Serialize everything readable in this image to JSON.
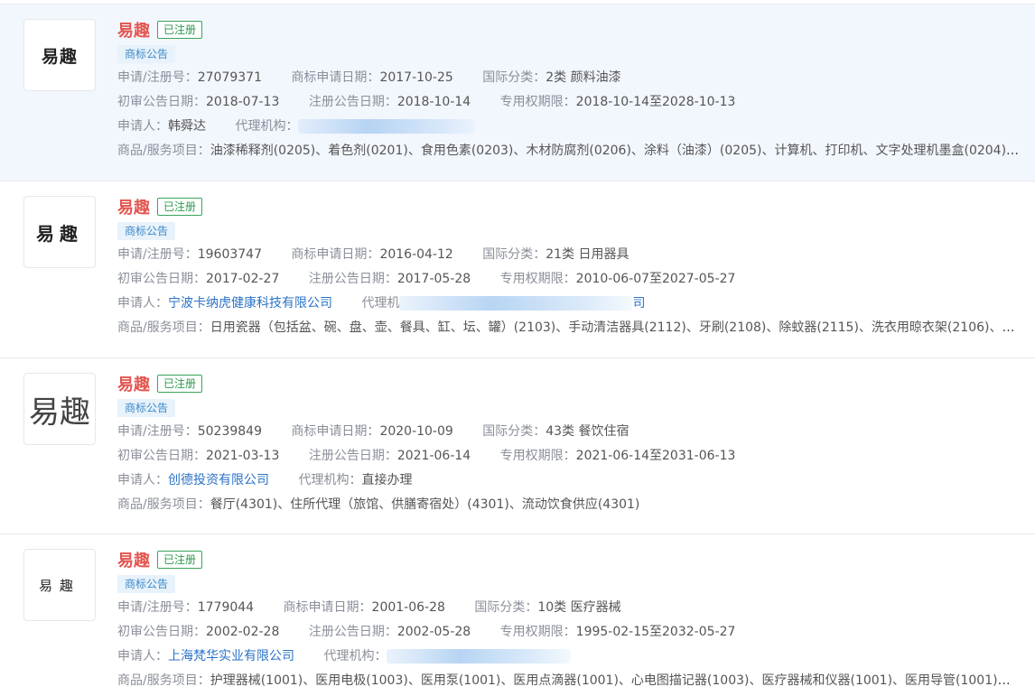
{
  "labels": {
    "reg_no": "申请/注册号：",
    "apply_date": "商标申请日期：",
    "intl_class": "国际分类：",
    "prelim_date": "初审公告日期：",
    "reg_date": "注册公告日期：",
    "exclusive_period": "专用权期限：",
    "applicant": "申请人：",
    "agency": "代理机构：",
    "agency_short": "代理机",
    "goods": "商品/服务项目："
  },
  "items": [
    {
      "logo_text": "易趣",
      "name": "易趣",
      "status": "已注册",
      "tag": "商标公告",
      "reg_no": "27079371",
      "apply_date": "2017-10-25",
      "intl_class": "2类 颜料油漆",
      "prelim_date": "2018-07-13",
      "reg_date": "2018-10-14",
      "exclusive_period": "2018-10-14至2028-10-13",
      "applicant": "韩舜达",
      "agency": "",
      "goods": "油漆稀释剂(0205)、着色剂(0201)、食用色素(0203)、木材防腐剂(0206)、涂料（油漆）(0205)、计算机、打印机、文字处理机墨盒(0204)、着..."
    },
    {
      "logo_text": "易趣",
      "name": "易趣",
      "status": "已注册",
      "tag": "商标公告",
      "reg_no": "19603747",
      "apply_date": "2016-04-12",
      "intl_class": "21类 日用器具",
      "prelim_date": "2017-02-27",
      "reg_date": "2017-05-28",
      "exclusive_period": "2010-06-07至2027-05-27",
      "applicant": "宁波卡纳虎健康科技有限公司",
      "agency": "司",
      "goods": "日用瓷器（包括盆、碗、盘、壶、餐具、缸、坛、罐）(2103)、手动清洁器具(2112)、牙刷(2108)、除蚊器(2115)、洗衣用晾衣架(2106)、家用..."
    },
    {
      "logo_text": "易趣",
      "name": "易趣",
      "status": "已注册",
      "tag": "商标公告",
      "reg_no": "50239849",
      "apply_date": "2020-10-09",
      "intl_class": "43类 餐饮住宿",
      "prelim_date": "2021-03-13",
      "reg_date": "2021-06-14",
      "exclusive_period": "2021-06-14至2031-06-13",
      "applicant": "创德投资有限公司",
      "agency": "直接办理",
      "goods": "餐厅(4301)、住所代理（旅馆、供膳寄宿处）(4301)、流动饮食供应(4301)"
    },
    {
      "logo_text": "易趣",
      "name": "易趣",
      "status": "已注册",
      "tag": "商标公告",
      "reg_no": "1779044",
      "apply_date": "2001-06-28",
      "intl_class": "10类 医疗器械",
      "prelim_date": "2002-02-28",
      "reg_date": "2002-05-28",
      "exclusive_period": "1995-02-15至2032-05-27",
      "applicant": "上海梵华实业有限公司",
      "agency": "",
      "goods": "护理器械(1001)、医用电极(1003)、医用泵(1001)、医用点滴器(1001)、心电图描记器(1003)、医疗器械和仪器(1001)、医用导管(1001)、外科..."
    }
  ]
}
